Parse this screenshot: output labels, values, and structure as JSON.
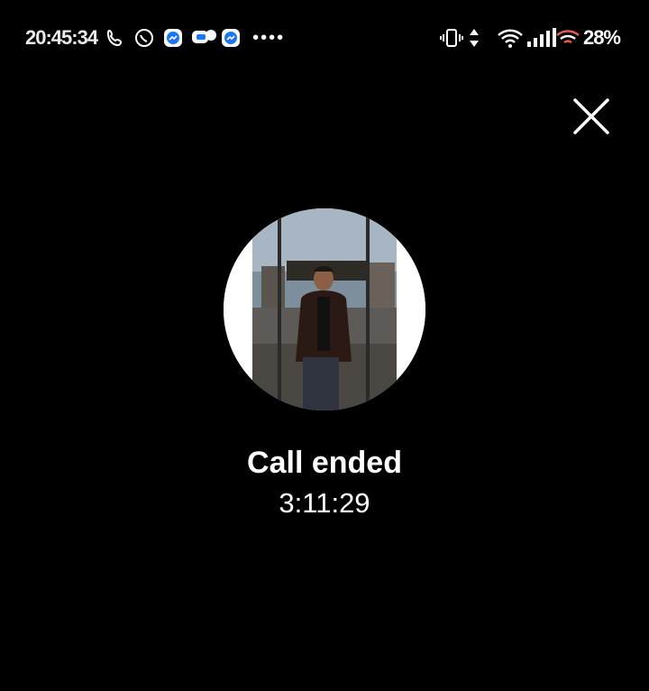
{
  "status_bar": {
    "time": "20:45:34",
    "notification_icons": [
      "call-icon",
      "phone-icon",
      "messenger-icon",
      "chat-icon",
      "messenger-icon"
    ],
    "more_indicator": "••••",
    "right_icons": [
      "vibrate-icon",
      "data-arrows-icon",
      "wifi-icon",
      "signal-icon"
    ],
    "battery": "28%"
  },
  "call": {
    "status_label": "Call ended",
    "duration": "3:11:29",
    "avatar_icon": "contact-avatar"
  },
  "controls": {
    "close_icon": "close-icon"
  },
  "colors": {
    "background": "#000000",
    "text": "#ffffff",
    "messenger_blue": "#1877f2"
  }
}
